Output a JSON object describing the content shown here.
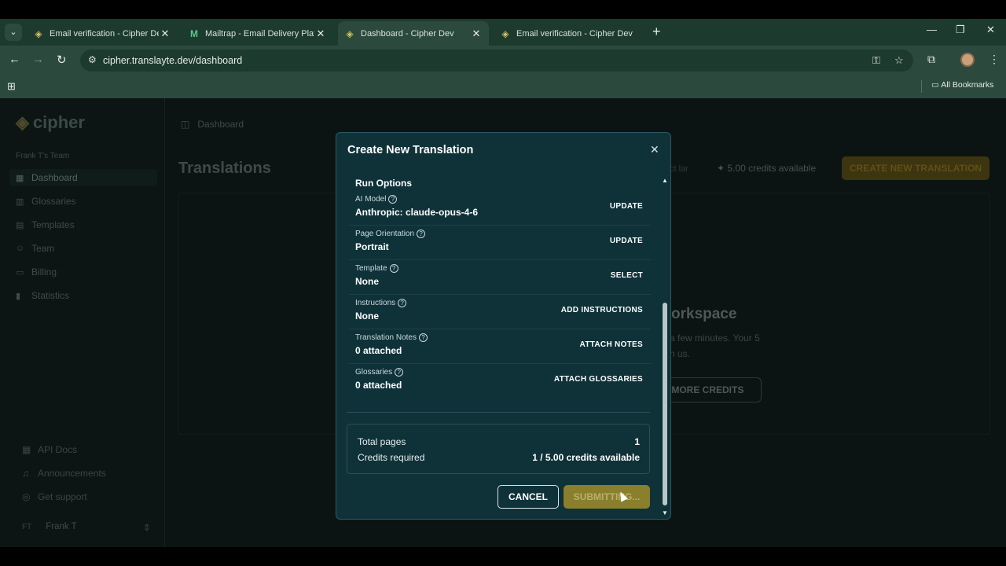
{
  "browser": {
    "tabs": [
      {
        "title": "Email verification - Cipher Dev",
        "icon": "cipher-layers-icon"
      },
      {
        "title": "Mailtrap - Email Delivery Platform",
        "icon": "mailtrap-m-icon"
      },
      {
        "title": "Dashboard - Cipher Dev",
        "icon": "cipher-layers-icon",
        "active": true
      },
      {
        "title": "Email verification - Cipher Dev",
        "icon": "cipher-layers-icon"
      }
    ],
    "url": "cipher.translayte.dev/dashboard",
    "bookmarks_label": "All Bookmarks"
  },
  "app": {
    "logo_text": "cipher",
    "team_name": "Frank T's Team",
    "nav": [
      {
        "label": "Dashboard",
        "icon": "grid-icon",
        "active": true
      },
      {
        "label": "Glossaries",
        "icon": "book-icon"
      },
      {
        "label": "Templates",
        "icon": "template-icon"
      },
      {
        "label": "Team",
        "icon": "users-icon"
      },
      {
        "label": "Billing",
        "icon": "card-icon"
      },
      {
        "label": "Statistics",
        "icon": "chart-icon"
      }
    ],
    "bottom_nav": [
      {
        "label": "API Docs",
        "icon": "grid-icon"
      },
      {
        "label": "Announcements",
        "icon": "bell-icon"
      },
      {
        "label": "Get support",
        "icon": "support-icon"
      }
    ],
    "user": {
      "initials": "FT",
      "name": "Frank T"
    },
    "breadcrumb": "Dashboard",
    "page_title": "Translations",
    "credits_available": "5.00 credits available",
    "partial_text": "ct lar",
    "create_button": "CREATE NEW TRANSLATION",
    "workspace_title": "orkspace",
    "workspace_line1": "a few minutes. Your 5",
    "workspace_line2": "n us.",
    "workspace_button": "E MORE CREDITS"
  },
  "modal": {
    "title": "Create New Translation",
    "section_title": "Run Options",
    "options": [
      {
        "label": "AI Model",
        "value": "Anthropic: claude-opus-4-6",
        "action": "UPDATE"
      },
      {
        "label": "Page Orientation",
        "value": "Portrait",
        "action": "UPDATE"
      },
      {
        "label": "Template",
        "value": "None",
        "action": "SELECT"
      },
      {
        "label": "Instructions",
        "value": "None",
        "action": "ADD INSTRUCTIONS"
      },
      {
        "label": "Translation Notes",
        "value": "0 attached",
        "action": "ATTACH NOTES"
      },
      {
        "label": "Glossaries",
        "value": "0 attached",
        "action": "ATTACH GLOSSARIES"
      }
    ],
    "summary": {
      "total_pages_label": "Total pages",
      "total_pages_value": "1",
      "credits_label": "Credits required",
      "credits_value": "1 / 5.00 credits available"
    },
    "cancel_label": "CANCEL",
    "submit_label": "SUBMITTING..."
  },
  "colors": {
    "browser_frame": "#1c3a2e",
    "modal_bg": "#0f3239",
    "submit_bg": "#8a7f2c",
    "app_bg": "#0b1412"
  }
}
